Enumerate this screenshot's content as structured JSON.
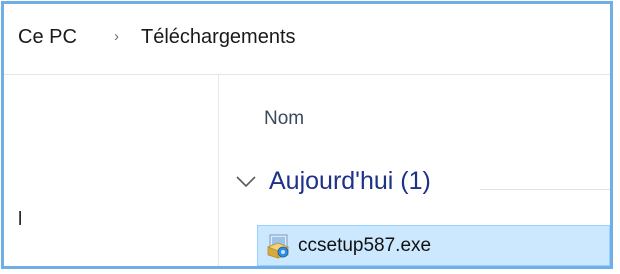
{
  "breadcrumb": {
    "items": [
      "Ce PC",
      "Téléchargements"
    ],
    "separator": "›"
  },
  "navigation_pane": {
    "partial_item_text": "l"
  },
  "file_list": {
    "column_header": "Nom",
    "group": {
      "label": "Aujourd'hui (1)",
      "expanded": true
    },
    "files": [
      {
        "name": "ccsetup587.exe",
        "icon": "installer-icon",
        "selected": true
      }
    ]
  },
  "colors": {
    "window_border": "#6faee6",
    "group_label": "#1e3287",
    "selection_background": "#cce8ff",
    "selection_border": "#99d1ff"
  }
}
